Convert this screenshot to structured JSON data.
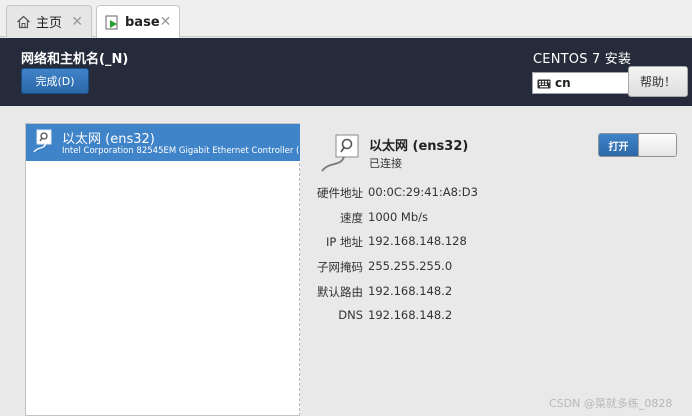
{
  "tabs": [
    {
      "label": "主页",
      "icon": "home-icon"
    },
    {
      "label": "base",
      "icon": "vm-icon"
    }
  ],
  "header": {
    "title": "网络和主机名(_N)",
    "done_label": "完成(D)",
    "product": "CENTOS 7 安装",
    "keyboard_layout": "cn",
    "help_label": "帮助！"
  },
  "device_list": [
    {
      "name": "以太网 (ens32)",
      "description": "Intel Corporation 82545EM Gigabit Ethernet Controller ("
    }
  ],
  "detail": {
    "name": "以太网 (ens32)",
    "status": "已连接",
    "toggle_label": "打开",
    "properties": [
      {
        "key": "硬件地址",
        "value": "00:0C:29:41:A8:D3"
      },
      {
        "key": "速度",
        "value": "1000 Mb/s"
      },
      {
        "key": "IP 地址",
        "value": "192.168.148.128"
      },
      {
        "key": "子网掩码",
        "value": "255.255.255.0"
      },
      {
        "key": "默认路由",
        "value": "192.168.148.2"
      },
      {
        "key": "DNS",
        "value": "192.168.148.2"
      }
    ]
  },
  "watermark": "CSDN @菜就多练_0828",
  "colors": {
    "header_bg": "#252b3a",
    "accent": "#3f83c8"
  }
}
